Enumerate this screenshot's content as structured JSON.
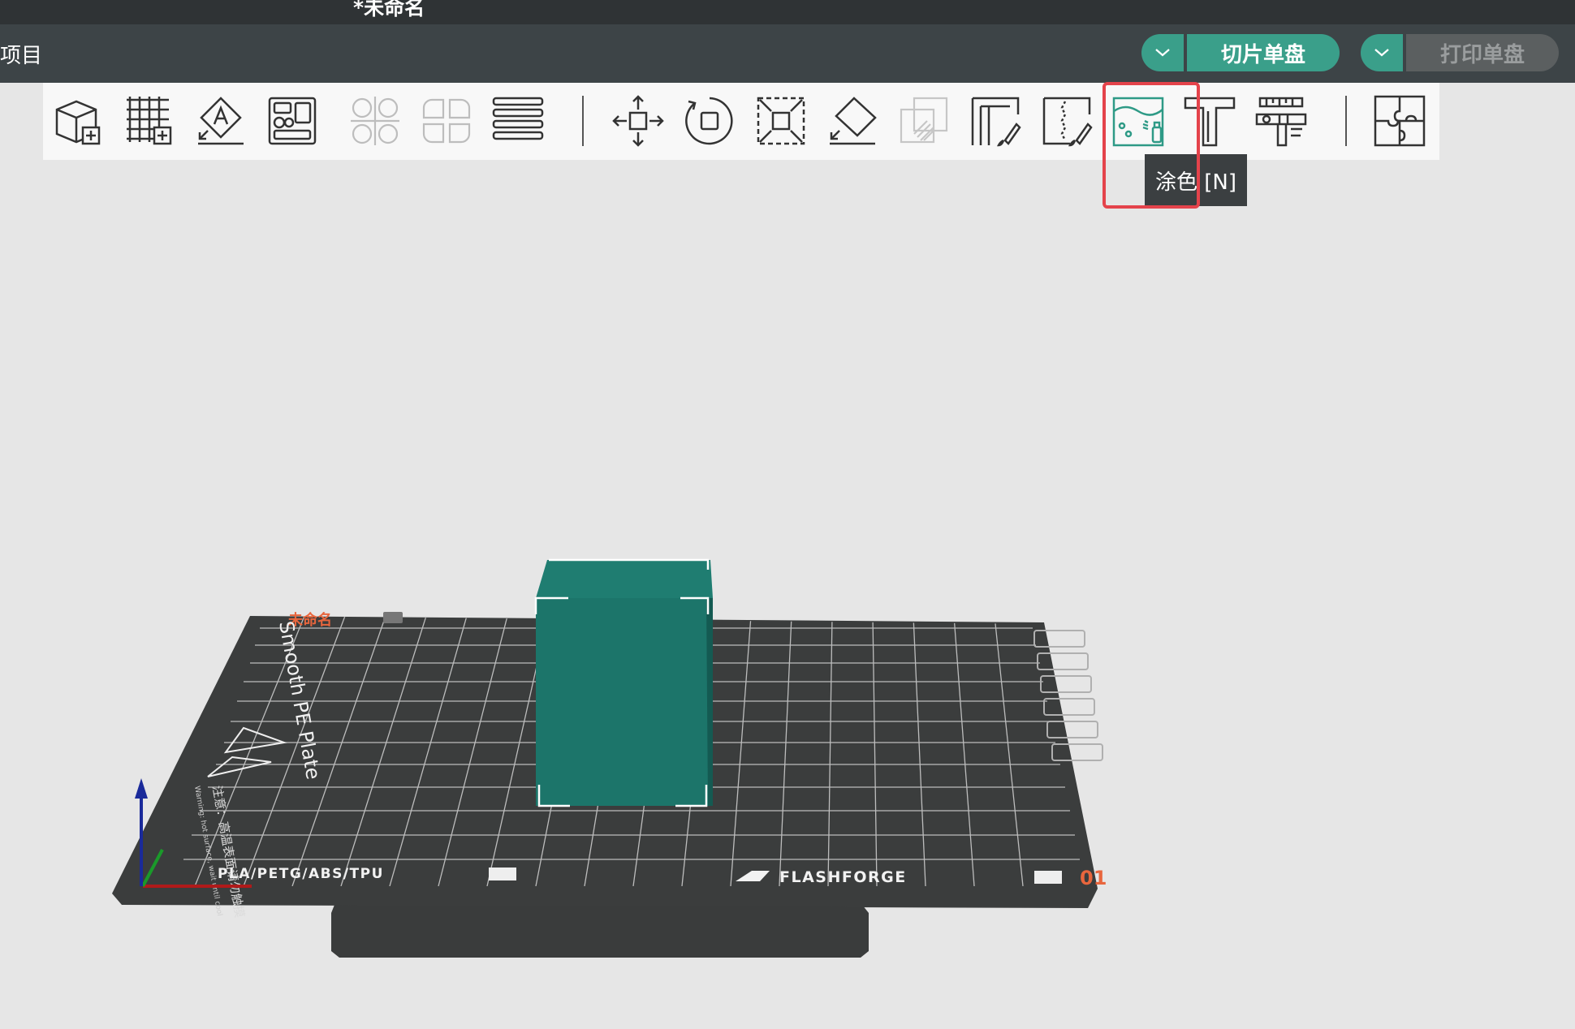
{
  "window": {
    "title": "*未命名"
  },
  "menubar": {
    "project_label": "项目"
  },
  "actions": {
    "slice_label": "切片单盘",
    "print_label": "打印单盘",
    "accent": "#3a9f8a"
  },
  "toolbar": {
    "tools": [
      "add-object-icon",
      "add-plate-icon",
      "auto-orient-icon",
      "arrange-icon",
      "split-objects-icon",
      "split-parts-icon",
      "layers-icon",
      "move-icon",
      "rotate-icon",
      "scale-icon",
      "lay-on-face-icon",
      "cut-icon",
      "support-paint-icon",
      "seam-paint-icon",
      "color-paint-icon",
      "text-icon",
      "measure-icon",
      "assembly-icon"
    ],
    "active_tool": "color-paint-icon"
  },
  "tooltip": {
    "text": "涂色 [N]"
  },
  "plate": {
    "name": "未命名",
    "surface_label": "Smooth PE Plate",
    "materials_label": "PLA/PETG/ABS/TPU",
    "brand_label": "FLASHFORGE",
    "warning_label": "注意：高温表面请勿触摸",
    "warning_en": "Warning: hot surface, wait until cool",
    "plate_number": "01",
    "plate_color": "#3b3d3d",
    "model_color": "#1c756a"
  }
}
